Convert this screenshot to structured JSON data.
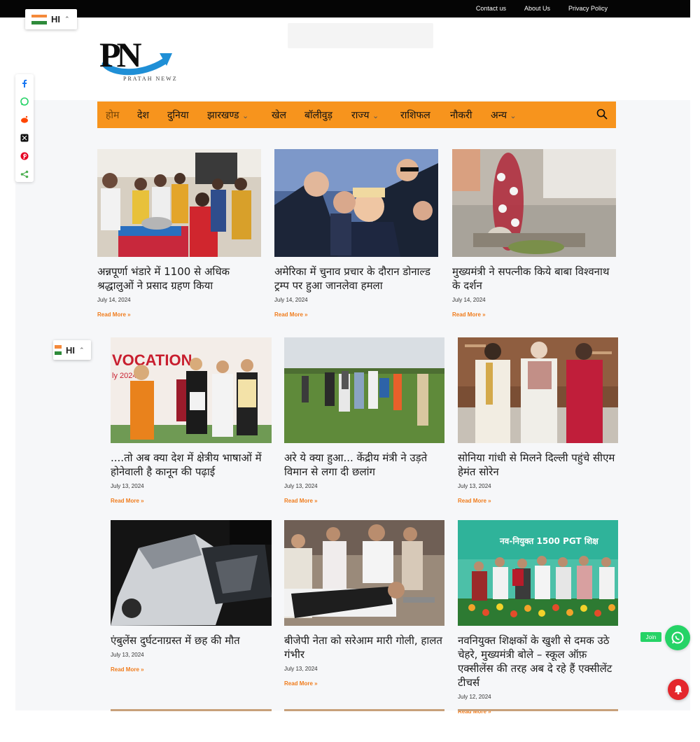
{
  "topbar": {
    "links": [
      "Contact us",
      "About Us",
      "Privacy Policy"
    ]
  },
  "language": {
    "code": "HI",
    "icon": "india-flag-icon"
  },
  "logo": {
    "initials": "PN",
    "tagline": "PRATAH NEWZ"
  },
  "share": {
    "icons": [
      "facebook-icon",
      "whatsapp-icon",
      "reddit-icon",
      "x-icon",
      "pinterest-icon",
      "share-icon"
    ]
  },
  "nav": {
    "items": [
      {
        "label": "होम",
        "has_dropdown": false
      },
      {
        "label": "देश",
        "has_dropdown": false
      },
      {
        "label": "दुनिया",
        "has_dropdown": false
      },
      {
        "label": "झारखण्ड",
        "has_dropdown": true
      },
      {
        "label": "खेल",
        "has_dropdown": false
      },
      {
        "label": "बॉलीवुड़",
        "has_dropdown": false
      },
      {
        "label": "राज्य",
        "has_dropdown": true
      },
      {
        "label": "राशिफल",
        "has_dropdown": false
      },
      {
        "label": "नौकरी",
        "has_dropdown": false
      },
      {
        "label": "अन्य",
        "has_dropdown": true
      }
    ],
    "accent": "#f7941d"
  },
  "articles": [
    {
      "title": "अन्नपूर्णा भंडारे में 1100 से अधिक श्रद्धालुओं ने प्रसाद ग्रहण किया",
      "date": "July 14, 2024",
      "read_more": "Read More »"
    },
    {
      "title": "अमेरिका में चुनाव प्रचार के दौरान डोनाल्ड ट्रम्प पर हुआ जानलेवा हमला",
      "date": "July 14, 2024",
      "read_more": "Read More »"
    },
    {
      "title": "मुख्यमंत्री ने सपत्नीक किये बाबा विश्वनाथ के दर्शन",
      "date": "July 14, 2024",
      "read_more": "Read More »"
    },
    {
      "title": "....तो अब क्या देश में क्षेत्रीय भाषाओं में होनेवाली है कानून की पढ़ाई",
      "date": "July 13, 2024",
      "read_more": "Read More »"
    },
    {
      "title": "अरे ये क्या हुआ... केंद्रीय मंत्री ने उड़ते विमान से लगा दी छलांग",
      "date": "July 13, 2024",
      "read_more": "Read More »"
    },
    {
      "title": "सोनिया गांधी से मिलने दिल्ली पहुंचे सीएम हेमंत सोरेन",
      "date": "July 13, 2024",
      "read_more": "Read More »"
    },
    {
      "title": "एंबुलेंस दुर्घटनाग्रस्त में छह की मौत",
      "date": "July 13, 2024",
      "read_more": "Read More »"
    },
    {
      "title": "बीजेपी नेता को सरेआम मारी गोली, हालत गंभीर",
      "date": "July 13, 2024",
      "read_more": "Read More »"
    },
    {
      "title": "नवनियुक्त शिक्षकों के खुशी से दमक उठे चेहरे, मुख्यमंत्री बोले – स्कूल ऑफ़ एक्सीलेंस की तरह अब दे रहे हैं एक्सीलेंट टीचर्स",
      "date": "July 12, 2024",
      "read_more": "Read More »"
    }
  ],
  "image_texts": {
    "convocation": "VOCATION",
    "convocation_year": "ly 2024",
    "teachers_banner": "नव-नियुक्त 1500 PGT शिक्ष"
  },
  "whatsapp": {
    "join_label": "Join"
  }
}
